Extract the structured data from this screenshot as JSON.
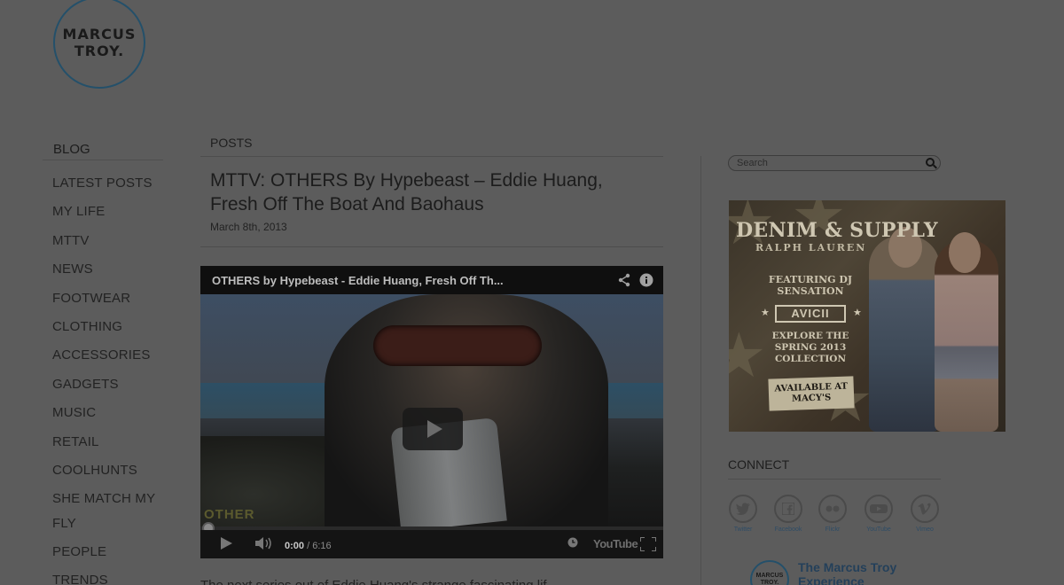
{
  "logo": {
    "line1": "MARCUS",
    "line2": "TROY."
  },
  "sidebar": {
    "title": "BLOG",
    "items": [
      {
        "label": "LATEST POSTS"
      },
      {
        "label": "MY LIFE"
      },
      {
        "label": "MTTV"
      },
      {
        "label": "NEWS"
      },
      {
        "label": "FOOTWEAR"
      },
      {
        "label": "CLOTHING"
      },
      {
        "label": "ACCESSORIES"
      },
      {
        "label": "GADGETS"
      },
      {
        "label": "MUSIC"
      },
      {
        "label": "RETAIL"
      },
      {
        "label": "COOLHUNTS"
      },
      {
        "label": "SHE MATCH MY FLY"
      },
      {
        "label": "PEOPLE"
      },
      {
        "label": "TRENDS"
      }
    ]
  },
  "main": {
    "section_label": "POSTS",
    "post": {
      "title": "MTTV: OTHERS By Hypebeast – Eddie Huang, Fresh Off The Boat And Baohaus",
      "date": "March 8th, 2013",
      "teaser": "The next series out of Eddie Huang's strange fascinating lif"
    },
    "video": {
      "title": "OTHERS by Hypebeast - Eddie Huang, Fresh Off Th...",
      "share_icon": "share-icon",
      "info_icon": "info-icon",
      "current_time": "0:00",
      "duration": "/ 6:16",
      "brand": "YouTube",
      "watermark": "OTHER"
    }
  },
  "search": {
    "placeholder": "Search"
  },
  "ad": {
    "headline": "DENIM & SUPPLY",
    "brand": "RALPH LAUREN",
    "featuring": "FEATURING DJ SENSATION",
    "artist": "AVICII",
    "explore": "EXPLORE THE SPRING 2013 COLLECTION",
    "badge": "AVAILABLE AT MACY'S"
  },
  "connect": {
    "title": "CONNECT",
    "networks": [
      {
        "label": "Twitter",
        "icon": "twitter-icon"
      },
      {
        "label": "Facebook",
        "icon": "facebook-icon"
      },
      {
        "label": "Flickr",
        "icon": "flickr-icon"
      },
      {
        "label": "YouTube",
        "icon": "youtube-icon"
      },
      {
        "label": "Vimeo",
        "icon": "vimeo-icon"
      }
    ],
    "promo": {
      "title_line1": "The Marcus Troy",
      "title_line2": "Experience"
    }
  }
}
